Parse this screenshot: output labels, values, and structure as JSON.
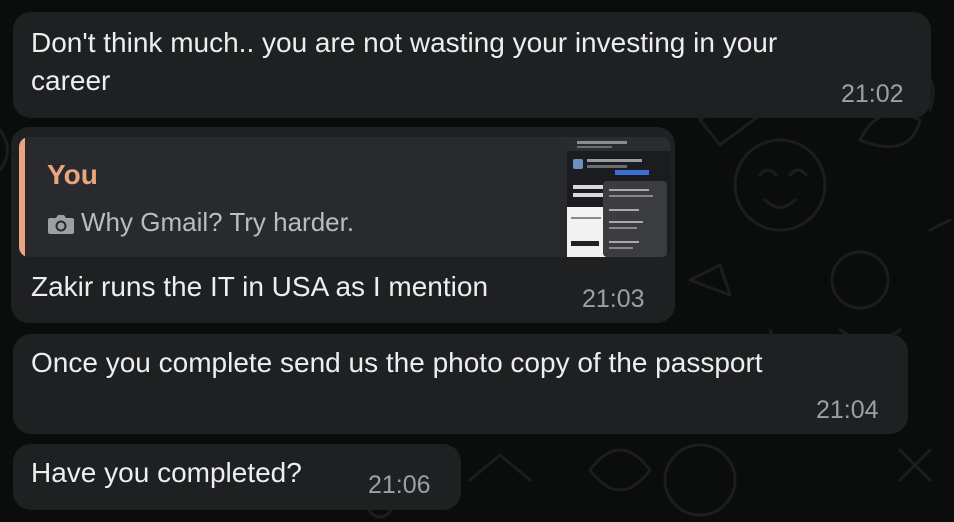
{
  "messages": [
    {
      "text_line1": "Don't think much.. you are not wasting your investing in your",
      "text_line2": "career",
      "time": "21:02"
    },
    {
      "quote": {
        "author": "You",
        "icon": "camera-icon",
        "text": "Why Gmail? Try harder."
      },
      "text": "Zakir runs the IT in USA as I mention",
      "time": "21:03"
    },
    {
      "text": "Once you complete send us the photo copy of the passport",
      "time": "21:04"
    },
    {
      "text": "Have you completed?",
      "time": "21:06"
    }
  ],
  "colors": {
    "bubble": "#1f2022",
    "quote_accent": "#e8a57f",
    "text": "#eceeef",
    "timestamp": "#9aa0a4"
  }
}
